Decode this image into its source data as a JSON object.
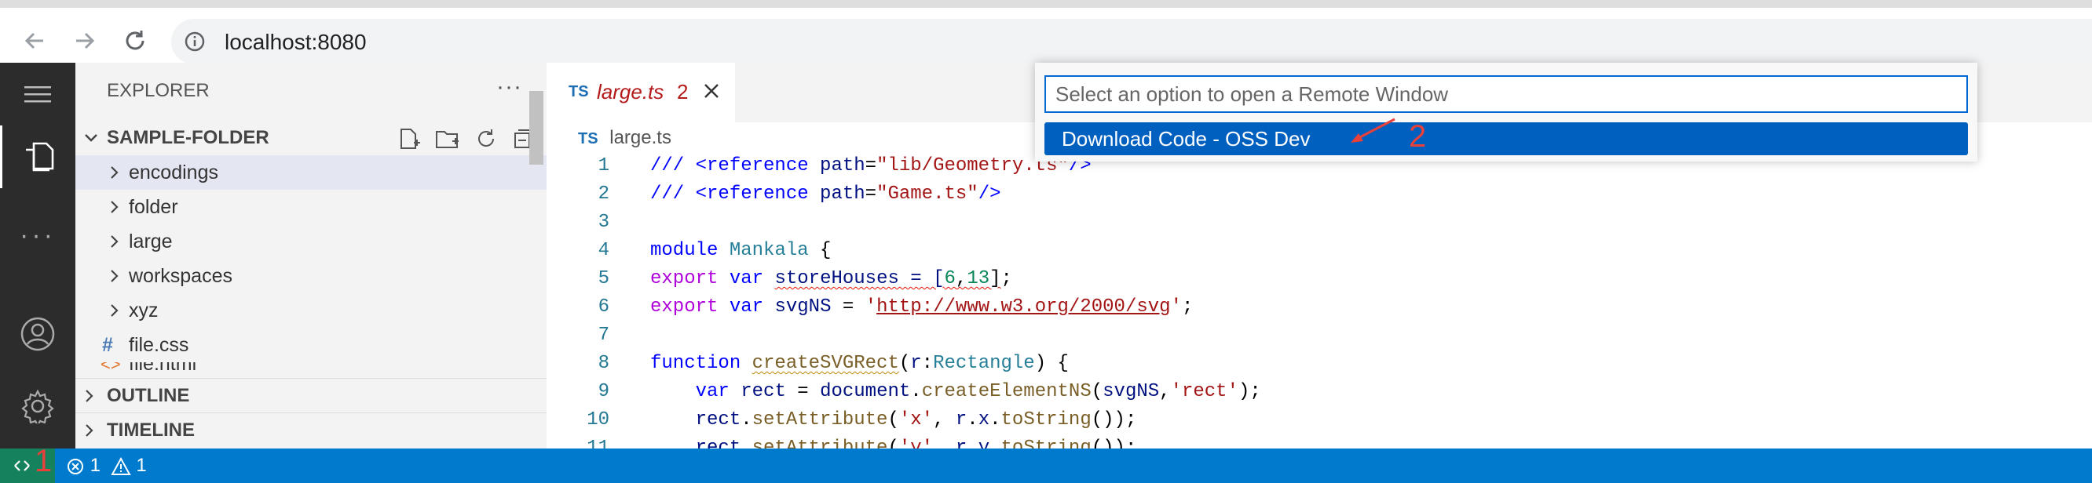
{
  "browser": {
    "url": "localhost:8080",
    "back_icon": "back-arrow-icon",
    "forward_icon": "forward-arrow-icon",
    "reload_icon": "reload-icon"
  },
  "sidebar": {
    "title": "EXPLORER",
    "folder": "SAMPLE-FOLDER",
    "items": [
      {
        "label": "encodings",
        "type": "folder"
      },
      {
        "label": "folder",
        "type": "folder"
      },
      {
        "label": "large",
        "type": "folder"
      },
      {
        "label": "workspaces",
        "type": "folder"
      },
      {
        "label": "xyz",
        "type": "folder"
      },
      {
        "label": "file.css",
        "type": "file",
        "icon": "#"
      },
      {
        "label": "file.html",
        "type": "file"
      }
    ],
    "outline": "OUTLINE",
    "timeline": "TIMELINE"
  },
  "editor": {
    "tab": {
      "lang": "TS",
      "name": "large.ts",
      "count": "2"
    },
    "breadcrumb": {
      "lang": "TS",
      "name": "large.ts"
    },
    "line_numbers": [
      "1",
      "2",
      "3",
      "4",
      "5",
      "6",
      "7",
      "8",
      "9",
      "10",
      "11"
    ]
  },
  "quickpick": {
    "placeholder": "Select an option to open a Remote Window",
    "item": "Download Code - OSS Dev",
    "annotation": "2"
  },
  "statusbar": {
    "remote_annotation": "1",
    "errors": "1",
    "warnings": "1"
  },
  "colors": {
    "accent": "#007acc",
    "selection": "#0060c0",
    "annotation": "#e8403a"
  }
}
